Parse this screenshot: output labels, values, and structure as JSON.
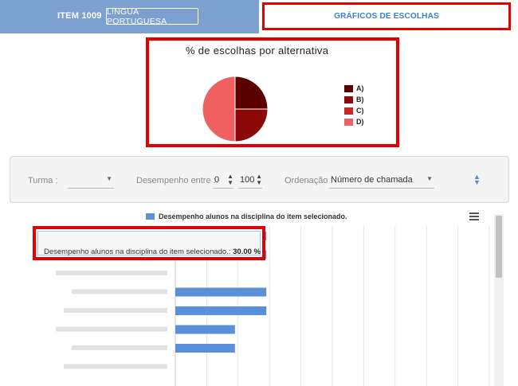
{
  "header": {
    "item_code": "ITEM 1009",
    "subject": "LÍNGUA PORTUGUESA",
    "active_tab": "GRÁFICOS DE ESCOLHAS"
  },
  "pie_chart": {
    "title": "% de escolhas por alternativa",
    "legend": [
      {
        "label": "A)",
        "color": "#5a0000"
      },
      {
        "label": "B)",
        "color": "#8e0a0a"
      },
      {
        "label": "C)",
        "color": "#c62828"
      },
      {
        "label": "D)",
        "color": "#f06060"
      }
    ]
  },
  "filters": {
    "turma_label": "Turma :",
    "turma_value": "",
    "desempenho_label": "Desempenho entre :",
    "desempenho_min": "0",
    "desempenho_max": "100",
    "ordenacao_label": "Ordenação :",
    "ordenacao_value": "Número de chamada"
  },
  "bar_chart": {
    "legend_label": "Desempenho alunos na disciplina do item selecionado.",
    "tooltip_label": "Desempenho alunos na disciplina do item selecionado.:",
    "tooltip_value": "30.00 %",
    "bar_color": "#5b8fd8"
  },
  "chart_data": [
    {
      "type": "pie",
      "title": "% de escolhas por alternativa",
      "categories": [
        "A)",
        "B)",
        "C)",
        "D)"
      ],
      "values": [
        25,
        25,
        0,
        50
      ],
      "colors": [
        "#5a0000",
        "#8e0a0a",
        "#c62828",
        "#f06060"
      ]
    },
    {
      "type": "bar",
      "orientation": "horizontal",
      "legend": "Desempenho alunos na disciplina do item selecionado.",
      "values": [
        30,
        30,
        0,
        30,
        30,
        20,
        20,
        0
      ],
      "xlim": [
        0,
        100
      ]
    }
  ]
}
